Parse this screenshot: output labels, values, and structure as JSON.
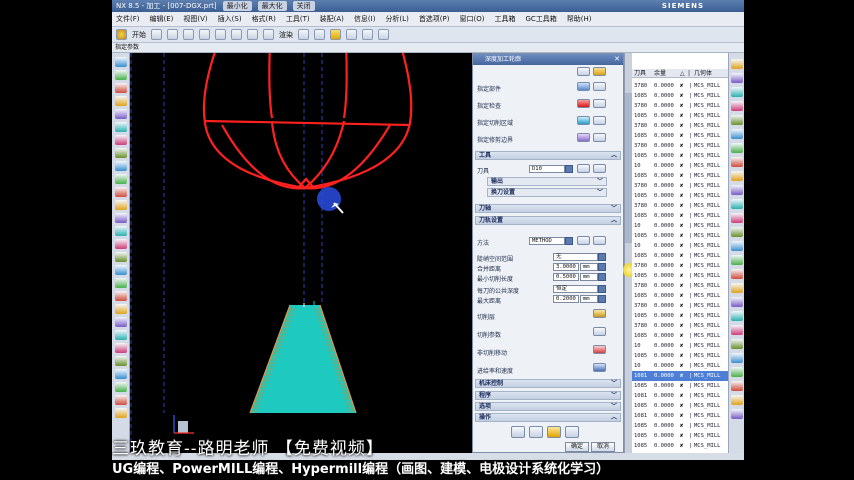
{
  "window": {
    "title": "NX 8.5 - 加工 - [007-DGX.prt]",
    "buttons": [
      "最小化",
      "最大化",
      "关闭"
    ],
    "brand": "SIEMENS"
  },
  "menu": [
    "文件(F)",
    "编辑(E)",
    "视图(V)",
    "插入(S)",
    "格式(R)",
    "工具(T)",
    "装配(A)",
    "信息(I)",
    "分析(L)",
    "首选项(P)",
    "窗口(O)",
    "工具箱",
    "GC工具箱",
    "帮助(H)"
  ],
  "toolbar": {
    "start_label": "开始",
    "view_label": "渲染"
  },
  "subbar_label": "指定参数",
  "dialog": {
    "title": "深度加工轮廓",
    "rows": {
      "part": "指定部件",
      "check": "指定检查",
      "cut_area": "指定切削区域",
      "trim": "指定修剪边界"
    },
    "sections": {
      "tool": "工具",
      "output": "输出",
      "tool_change": "换刀设置",
      "tool_axis": "刀轴",
      "path_settings": "刀轨设置",
      "machine": "机床控制",
      "program": "程序",
      "options": "选项",
      "actions": "操作"
    },
    "tool_label": "刀具",
    "tool_value": "D10",
    "method_label": "方法",
    "method_value": "METHOD",
    "params": [
      {
        "label": "陡峭空间范围",
        "value": "无"
      },
      {
        "label": "合并距离",
        "value": "3.0000",
        "unit": "mm"
      },
      {
        "label": "最小切削长度",
        "value": "0.5000",
        "unit": "mm"
      },
      {
        "label": "每刀的公共深度",
        "value": "恒定"
      },
      {
        "label": "最大距离",
        "value": "0.2000",
        "unit": "mm"
      }
    ],
    "links": [
      "切削层",
      "切削参数",
      "非切削移动",
      "进给率和速度"
    ],
    "ok_label": "确定",
    "cancel_label": "取消"
  },
  "nav": {
    "headers": [
      "刀具",
      "余量",
      "几何体"
    ],
    "rows": [
      {
        "tool": "3780",
        "stock": "0.0000",
        "geom": "MCS_MILL"
      },
      {
        "tool": "1085",
        "stock": "0.0000",
        "geom": "MCS_MILL"
      },
      {
        "tool": "3780",
        "stock": "0.0000",
        "geom": "MCS_MILL"
      },
      {
        "tool": "1085",
        "stock": "0.0000",
        "geom": "MCS_MILL"
      },
      {
        "tool": "3780",
        "stock": "0.0000",
        "geom": "MCS_MILL"
      },
      {
        "tool": "1085",
        "stock": "0.0000",
        "geom": "MCS_MILL"
      },
      {
        "tool": "3780",
        "stock": "0.0000",
        "geom": "MCS_MILL"
      },
      {
        "tool": "1085",
        "stock": "0.0000",
        "geom": "MCS_MILL"
      },
      {
        "tool": "10",
        "stock": "0.0000",
        "geom": "MCS_MILL"
      },
      {
        "tool": "1085",
        "stock": "0.0000",
        "geom": "MCS_MILL"
      },
      {
        "tool": "3780",
        "stock": "0.0000",
        "geom": "MCS_MILL"
      },
      {
        "tool": "1085",
        "stock": "0.0000",
        "geom": "MCS_MILL"
      },
      {
        "tool": "3780",
        "stock": "0.0000",
        "geom": "MCS_MILL"
      },
      {
        "tool": "1085",
        "stock": "0.0000",
        "geom": "MCS_MILL"
      },
      {
        "tool": "10",
        "stock": "0.0000",
        "geom": "MCS_MILL"
      },
      {
        "tool": "1085",
        "stock": "0.0000",
        "geom": "MCS_MILL"
      },
      {
        "tool": "10",
        "stock": "0.0000",
        "geom": "MCS_MILL"
      },
      {
        "tool": "1085",
        "stock": "0.0000",
        "geom": "MCS_MILL"
      },
      {
        "tool": "3780",
        "stock": "0.0000",
        "geom": "MCS_MILL"
      },
      {
        "tool": "1085",
        "stock": "0.0000",
        "geom": "MCS_MILL"
      },
      {
        "tool": "3780",
        "stock": "0.0000",
        "geom": "MCS_MILL"
      },
      {
        "tool": "1085",
        "stock": "0.0000",
        "geom": "MCS_MILL"
      },
      {
        "tool": "3780",
        "stock": "0.0000",
        "geom": "MCS_MILL"
      },
      {
        "tool": "1085",
        "stock": "0.0000",
        "geom": "MCS_MILL"
      },
      {
        "tool": "3780",
        "stock": "0.0000",
        "geom": "MCS_MILL"
      },
      {
        "tool": "1085",
        "stock": "0.0000",
        "geom": "MCS_MILL"
      },
      {
        "tool": "10",
        "stock": "0.0000",
        "geom": "MCS_MILL"
      },
      {
        "tool": "1085",
        "stock": "0.0000",
        "geom": "MCS_MILL"
      },
      {
        "tool": "10",
        "stock": "0.0000",
        "geom": "MCS_MILL"
      },
      {
        "tool": "1081",
        "stock": "0.0000",
        "geom": "MCS_MILL"
      },
      {
        "tool": "1085",
        "stock": "0.0000",
        "geom": "MCS_MILL"
      },
      {
        "tool": "1081",
        "stock": "0.0000",
        "geom": "MCS_MILL"
      },
      {
        "tool": "1085",
        "stock": "0.0000",
        "geom": "MCS_MILL"
      },
      {
        "tool": "1081",
        "stock": "0.0000",
        "geom": "MCS_MILL"
      },
      {
        "tool": "1085",
        "stock": "0.0000",
        "geom": "MCS_MILL"
      },
      {
        "tool": "1085",
        "stock": "0.0000",
        "geom": "MCS_MILL"
      },
      {
        "tool": "1085",
        "stock": "0.0000",
        "geom": "MCS_MILL"
      },
      {
        "tool": "1085",
        "stock": "0.0000",
        "geom": "MCS_MILL"
      }
    ],
    "selected_row": 29
  },
  "captions": {
    "line1": "三玖教育--路明老师  【免费视频】",
    "line2": "UG编程、PowerMILL编程、Hypermill编程（画图、建模、电极设计系统化学习）"
  },
  "colors": {
    "accent": "#4a6fa5",
    "wire": "#ff2020",
    "part": "#1ec9c0",
    "cursor": "#2a4ee0"
  }
}
